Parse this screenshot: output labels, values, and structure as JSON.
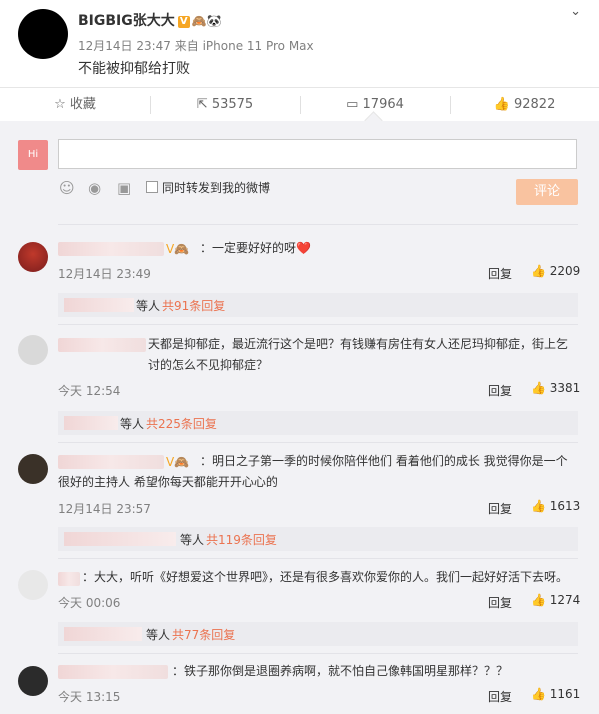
{
  "post": {
    "username": "BIGBIG张大大",
    "verified_badge": "V",
    "meta": "12月14日 23:47 来自 iPhone 11 Pro Max",
    "text": "不能被抑郁给打败",
    "more_icon": "chevron-down-icon"
  },
  "actions": {
    "favorite_label": "收藏",
    "share_count": "53575",
    "comment_count": "17964",
    "like_count": "92822"
  },
  "composer": {
    "checkbox_label": "同时转发到我的微博",
    "submit_label": "评论"
  },
  "comments": [
    {
      "text": "：一定要好好的呀❤️",
      "time": "12月14日 23:49",
      "reply_label": "回复",
      "likes": "2209",
      "replies": {
        "prefix": "等人",
        "count": "共91条回复"
      }
    },
    {
      "text": "天都是抑郁症，最近流行这个是吧？有钱赚有房住有女人还尼玛抑郁症，街上乞讨的怎么不见抑郁症？",
      "time": "今天 12:54",
      "reply_label": "回复",
      "likes": "3381",
      "replies": {
        "prefix": "等人",
        "count": "共225条回复"
      }
    },
    {
      "text": "：明日之子第一季的时候你陪伴他们 看着他们的成长 我觉得你是一个很好的主持人 希望你每天都能开开心心的",
      "time": "12月14日 23:57",
      "reply_label": "回复",
      "likes": "1613",
      "replies": {
        "prefix": "等人",
        "count": "共119条回复"
      }
    },
    {
      "text": "：大大，听听《好想爱这个世界吧》，还是有很多喜欢你爱你的人。我们一起好好活下去呀。",
      "time": "今天 00:06",
      "reply_label": "回复",
      "likes": "1274",
      "replies": {
        "prefix": "等人",
        "count": "共77条回复"
      }
    },
    {
      "text": "：铁子那你倒是退圈养病啊，就不怕自己像韩国明星那样？？？",
      "time": "今天 13:15",
      "reply_label": "回复",
      "likes": "1161"
    }
  ]
}
